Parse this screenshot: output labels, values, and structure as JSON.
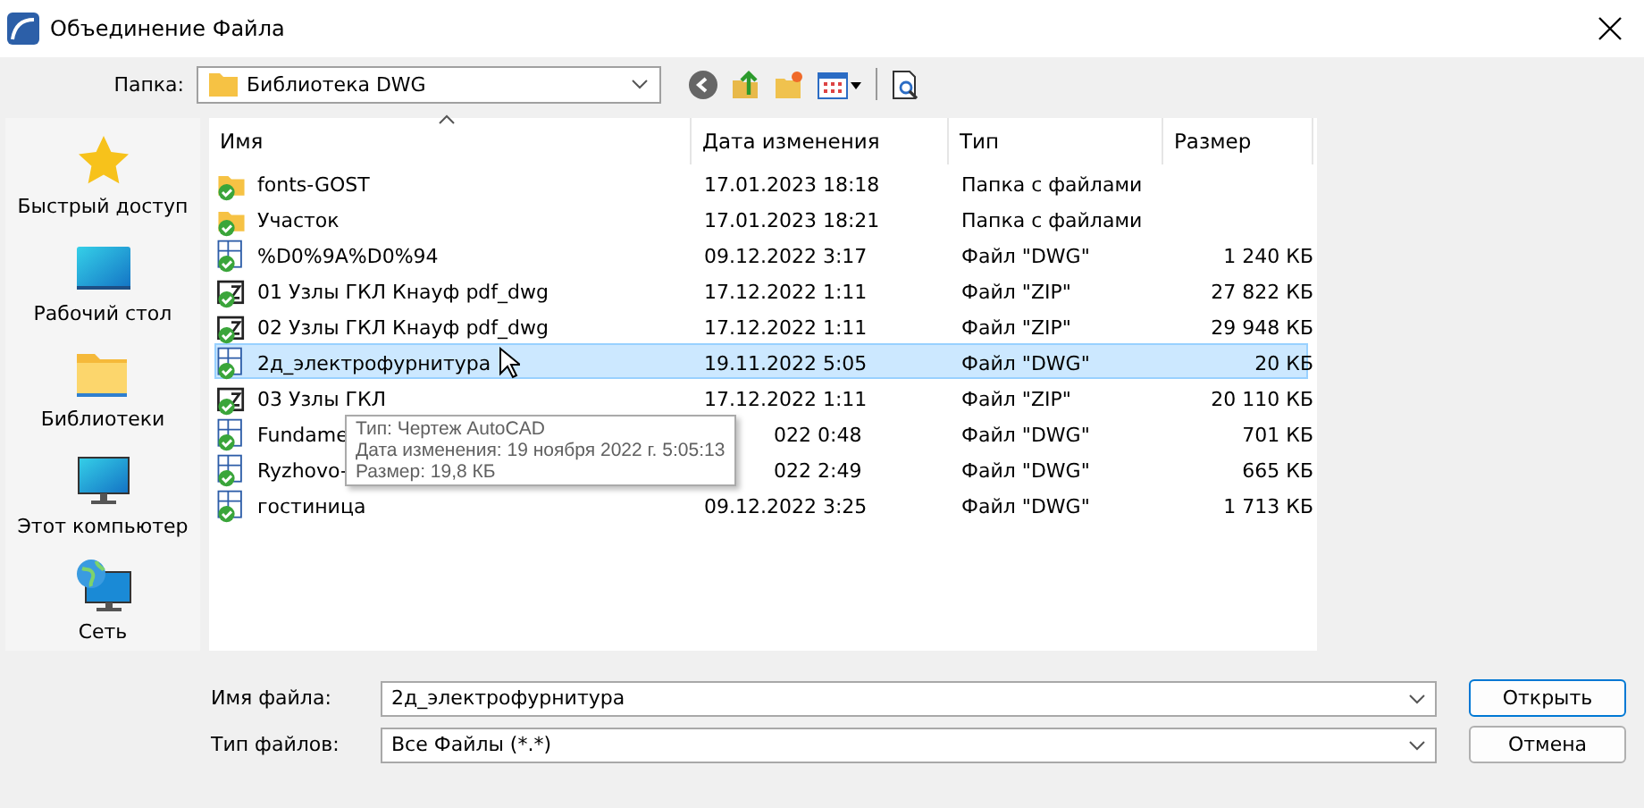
{
  "window": {
    "title": "Объединение Файла"
  },
  "toolbar": {
    "folder_label": "Папка:",
    "folder": "Библиотека DWG"
  },
  "places": [
    {
      "label": "Быстрый доступ",
      "kind": "star"
    },
    {
      "label": "Рабочий стол",
      "kind": "desktop"
    },
    {
      "label": "Библиотеки",
      "kind": "libraries"
    },
    {
      "label": "Этот компьютер",
      "kind": "computer"
    },
    {
      "label": "Сеть",
      "kind": "network"
    }
  ],
  "table": {
    "columns": [
      "Имя",
      "Дата изменения",
      "Тип",
      "Размер"
    ],
    "rows": [
      {
        "kind": "folder",
        "name": "fonts-GOST",
        "date": "17.01.2023 18:18",
        "type": "Папка с файлами",
        "size": "",
        "selected": false
      },
      {
        "kind": "folder",
        "name": "Участок",
        "date": "17.01.2023 18:21",
        "type": "Папка с файлами",
        "size": "",
        "selected": false
      },
      {
        "kind": "dwg",
        "name": "%D0%9A%D0%94",
        "date": "09.12.2022 3:17",
        "type": "Файл \"DWG\"",
        "size": "1 240 КБ",
        "selected": false
      },
      {
        "kind": "zip",
        "name": "01 Узлы ГКЛ Кнауф pdf_dwg",
        "date": "17.12.2022 1:11",
        "type": "Файл \"ZIP\"",
        "size": "27 822 КБ",
        "selected": false
      },
      {
        "kind": "zip",
        "name": "02 Узлы ГКЛ Кнауф pdf_dwg",
        "date": "17.12.2022 1:11",
        "type": "Файл \"ZIP\"",
        "size": "29 948 КБ",
        "selected": false
      },
      {
        "kind": "dwg",
        "name": "2д_электрофурнитура",
        "date": "19.11.2022 5:05",
        "type": "Файл \"DWG\"",
        "size": "20 КБ",
        "selected": true
      },
      {
        "kind": "zip",
        "name": "03 Узлы ГКЛ",
        "date": "17.12.2022 1:11",
        "type": "Файл \"ZIP\"",
        "size": "20 110 КБ",
        "selected": false
      },
      {
        "kind": "dwg",
        "name": "Fundame",
        "date_partial": "022 0:48",
        "type": "Файл \"DWG\"",
        "size": "701 КБ",
        "selected": false
      },
      {
        "kind": "dwg",
        "name": "Ryzhovo-",
        "date_partial": "022 2:49",
        "type": "Файл \"DWG\"",
        "size": "665 КБ",
        "selected": false
      },
      {
        "kind": "dwg",
        "name": "гостиница",
        "date": "09.12.2022 3:25",
        "type": "Файл \"DWG\"",
        "size": "1 713 КБ",
        "selected": false
      }
    ]
  },
  "tooltip": [
    "Тип: Чертеж AutoCAD",
    "Дата изменения: 19 ноября 2022 г. 5:05:13",
    "Размер: 19,8 КБ"
  ],
  "file_name": {
    "label": "Имя файла:",
    "value": "2д_электрофурнитура"
  },
  "file_type": {
    "label": "Тип файлов:",
    "value": "Все Файлы (*.*)"
  },
  "buttons": [
    "Открыть",
    "Отмена"
  ]
}
